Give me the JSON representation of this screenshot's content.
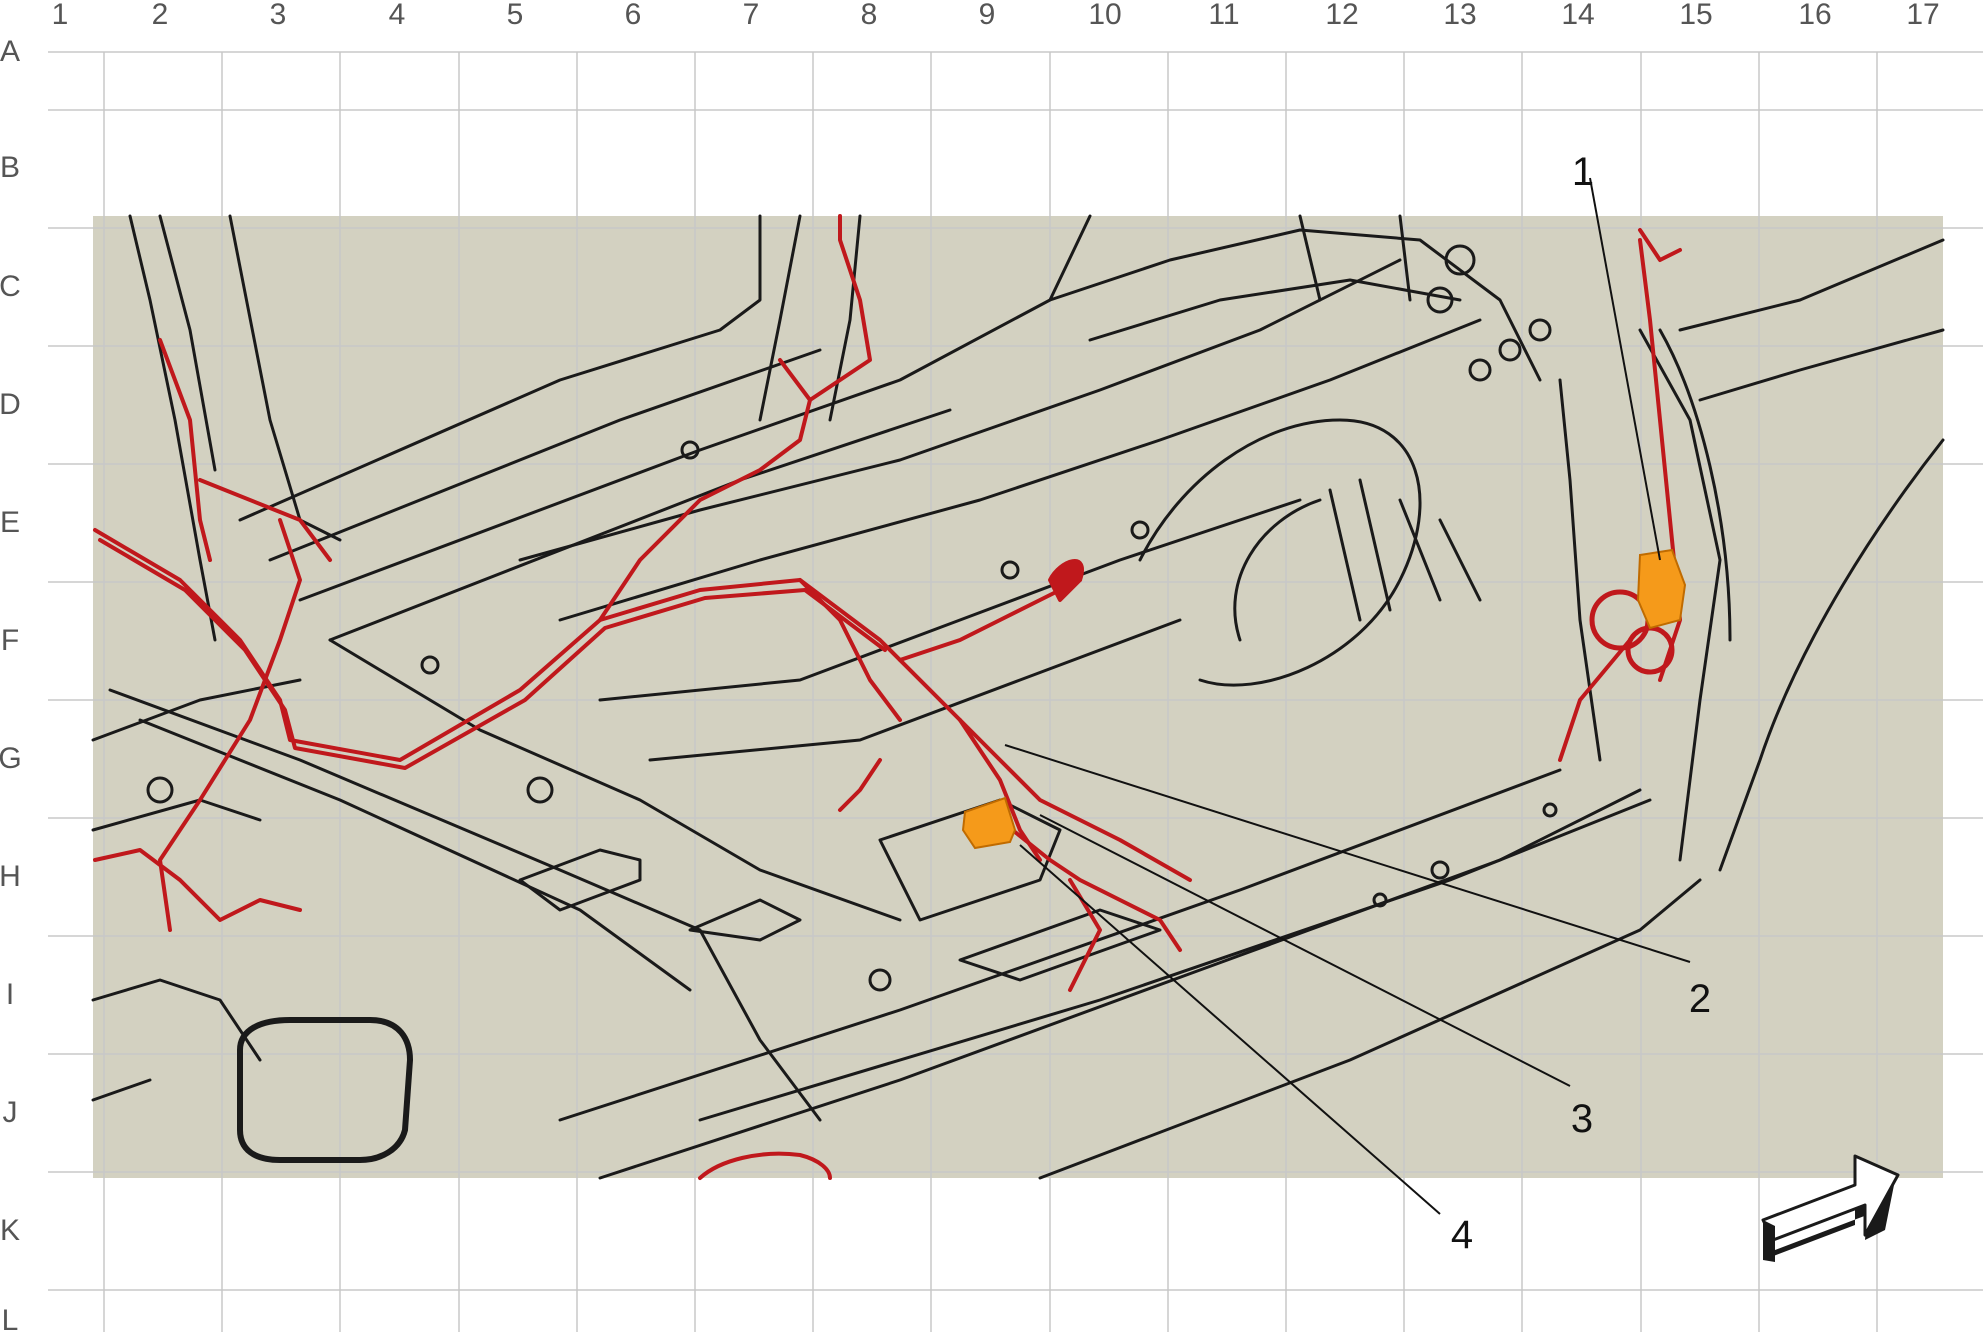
{
  "grid": {
    "columns": [
      "1",
      "2",
      "3",
      "4",
      "5",
      "6",
      "7",
      "8",
      "9",
      "10",
      "11",
      "12",
      "13",
      "14",
      "15",
      "16",
      "17"
    ],
    "rows": [
      "A",
      "B",
      "C",
      "D",
      "E",
      "F",
      "G",
      "H",
      "I",
      "J",
      "K",
      "L"
    ]
  },
  "callouts": [
    {
      "number": "1"
    },
    {
      "number": "2"
    },
    {
      "number": "3"
    },
    {
      "number": "4"
    }
  ],
  "colors": {
    "panel_fill": "#d3d1c1",
    "line_work": "#1a1a1a",
    "harness": "#c0181c",
    "highlight_component": "#f59a1a",
    "grid_line": "#c8c8c8"
  },
  "icons": {
    "direction_arrow": "forward-direction-arrow-icon"
  }
}
